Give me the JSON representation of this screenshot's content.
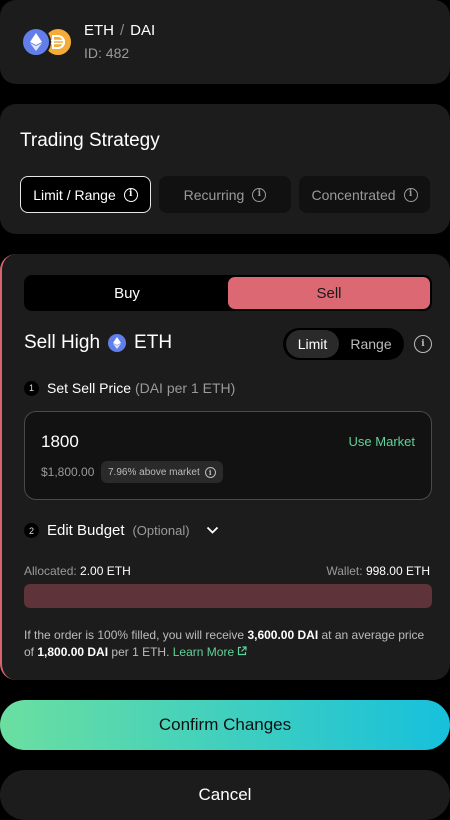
{
  "pair": {
    "base": "ETH",
    "quote": "DAI",
    "separator": "/",
    "id": "ID: 482",
    "base_icon": "eth-icon",
    "quote_icon": "dai-icon"
  },
  "strategy": {
    "title": "Trading Strategy",
    "tabs": [
      {
        "label": "Limit / Range",
        "active": true
      },
      {
        "label": "Recurring",
        "active": false
      },
      {
        "label": "Concentrated",
        "active": false
      }
    ]
  },
  "order": {
    "side_tabs": [
      {
        "label": "Buy",
        "active": false
      },
      {
        "label": "Sell",
        "active": true
      }
    ],
    "title": "Sell High",
    "asset": "ETH",
    "modes": [
      {
        "label": "Limit",
        "active": true
      },
      {
        "label": "Range",
        "active": false
      }
    ],
    "step1": {
      "number": "1",
      "label": "Set Sell Price",
      "sub": "(DAI per 1 ETH)"
    },
    "price": {
      "value": "1800",
      "use_market": "Use Market",
      "usd": "$1,800.00",
      "badge": "7.96% above market"
    },
    "step2": {
      "number": "2",
      "label": "Edit Budget",
      "optional": "(Optional)"
    },
    "allocated_label": "Allocated:",
    "allocated_value": "2.00 ETH",
    "wallet_label": "Wallet:",
    "wallet_value": "998.00 ETH",
    "budget_fill": 1.0,
    "summary": {
      "p1": "If the order is 100% filled, you will receive ",
      "amount": "3,600.00 DAI",
      "p2": " at an average price of ",
      "price": "1,800.00 DAI",
      "p3": " per 1 ETH. ",
      "learn_more": "Learn More"
    }
  },
  "buttons": {
    "confirm": "Confirm Changes",
    "cancel": "Cancel"
  },
  "colors": {
    "sell_accent": "#dc6873",
    "market_green": "#5ed39a",
    "confirm_gradient_start": "#6bdfa0",
    "confirm_gradient_end": "#17c0dc"
  }
}
